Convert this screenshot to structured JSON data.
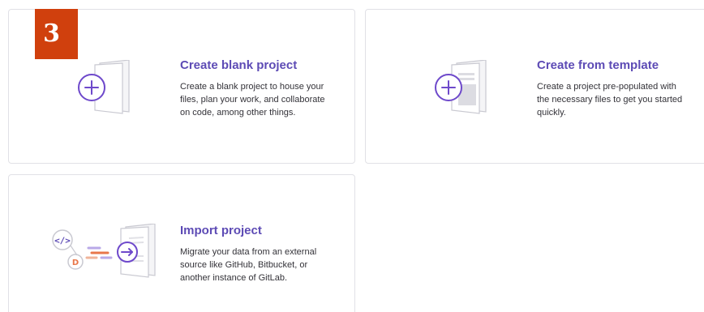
{
  "step_badge": "3",
  "cards": [
    {
      "title": "Create blank project",
      "description": "Create a blank project to house your files, plan your work, and collaborate on code, among other things."
    },
    {
      "title": "Create from template",
      "description": "Create a project pre-populated with the necessary files to get you started quickly."
    },
    {
      "title": "Import project",
      "description": "Migrate your data from an external source like GitHub, Bitbucket, or another instance of GitLab."
    }
  ],
  "icons": {
    "blank": "blank-project-illustration-icon",
    "template": "template-project-illustration-icon",
    "import": "import-project-illustration-icon"
  },
  "colors": {
    "accent": "#5d4bb5",
    "badge": "#d0400d",
    "import_orange": "#e8774a"
  }
}
